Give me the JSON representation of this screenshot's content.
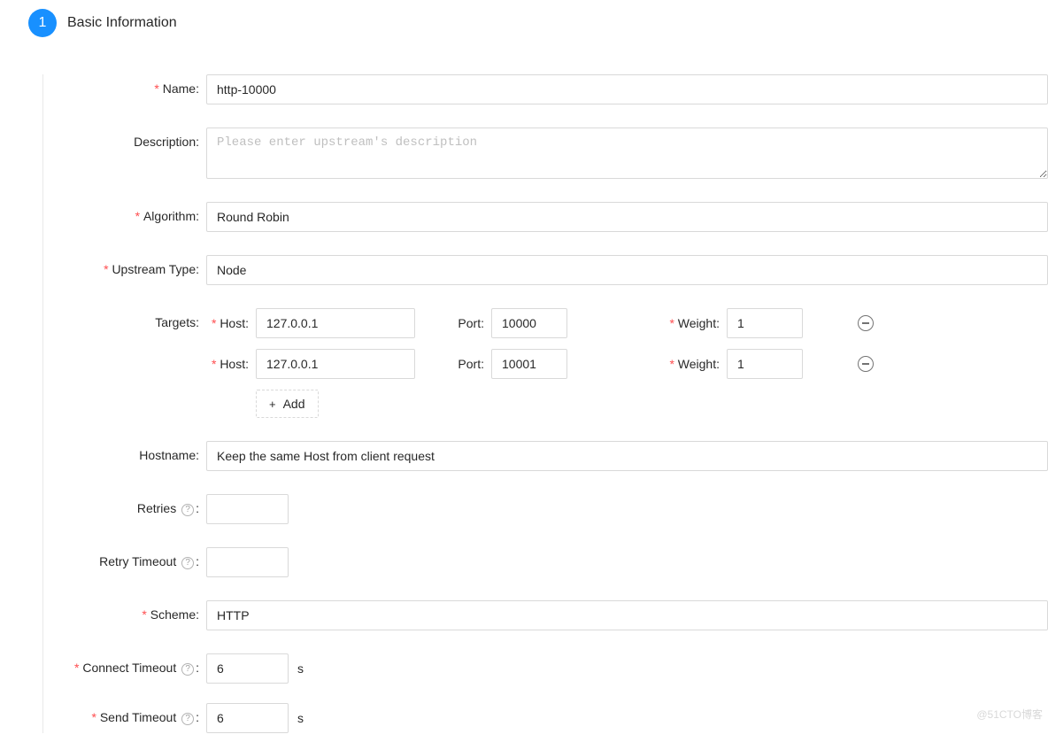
{
  "step": {
    "number": "1",
    "title": "Basic Information"
  },
  "labels": {
    "name": "Name",
    "description": "Description",
    "algorithm": "Algorithm",
    "upstream_type": "Upstream Type",
    "targets": "Targets",
    "host": "Host",
    "port": "Port",
    "weight": "Weight",
    "add": "Add",
    "hostname": "Hostname",
    "retries": "Retries",
    "retry_timeout": "Retry Timeout",
    "scheme": "Scheme",
    "connect_timeout": "Connect Timeout",
    "send_timeout": "Send Timeout",
    "unit_seconds": "s",
    "colon": ":"
  },
  "placeholders": {
    "description": "Please enter upstream's description"
  },
  "values": {
    "name": "http-10000",
    "description": "",
    "algorithm": "Round Robin",
    "upstream_type": "Node",
    "hostname": "Keep the same Host from client request",
    "retries": "",
    "retry_timeout": "",
    "scheme": "HTTP",
    "connect_timeout": "6",
    "send_timeout": "6"
  },
  "targets": [
    {
      "host": "127.0.0.1",
      "port": "10000",
      "weight": "1"
    },
    {
      "host": "127.0.0.1",
      "port": "10001",
      "weight": "1"
    }
  ],
  "watermark": "@51CTO博客"
}
